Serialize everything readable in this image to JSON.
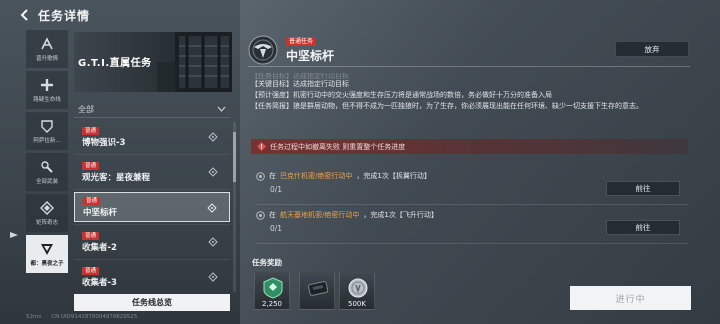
{
  "header": {
    "title": "任务详情"
  },
  "rail": {
    "items": [
      {
        "label": "晋升歌情",
        "icon": "chevron-a-icon",
        "active": false
      },
      {
        "label": "路疑生命线",
        "icon": "plus-cross-icon",
        "active": false
      },
      {
        "label": "阿萨拉新...",
        "icon": "shield-icon",
        "active": false
      },
      {
        "label": "全部武装",
        "icon": "wrench-icon",
        "active": false
      },
      {
        "label": "矩阵奇志",
        "icon": "diamond-icon",
        "active": false
      },
      {
        "label": "都：黑夜之子",
        "icon": "triangle-v-icon",
        "active": true
      }
    ]
  },
  "banner": {
    "title": "G.T.I.直属任务"
  },
  "filter": {
    "label": "全部"
  },
  "tasks": [
    {
      "tag": "普通",
      "name": "博物强识-3",
      "active": false
    },
    {
      "tag": "普通",
      "name": "观光客：星夜兼程",
      "active": false
    },
    {
      "tag": "普通",
      "name": "中坚标杆",
      "active": true
    },
    {
      "tag": "普通",
      "name": "收集者-2",
      "active": false
    },
    {
      "tag": "普通",
      "name": "收集者-3",
      "active": false
    }
  ],
  "overview_button": "任务线总览",
  "footer": {
    "fps": "52ms",
    "uid": "CN UID9142870004879829525"
  },
  "detail": {
    "tag": "普通任务",
    "title": "中坚标杆",
    "abandon_label": "放弃",
    "desc_faded": "【任务目标】达成指定行动目标",
    "desc_lines": [
      "【关键目标】达成指定行动目标",
      "【预计强度】机密行动中的交火强度和生存压力将是通常战场的数倍，务必做好十万分的准备入局",
      "【任务简报】狼是群居动物，但不得不成为一匹独狼时，为了生存，你必须展现出能在任何环境、缺少一切支援下生存的意志。"
    ],
    "warning": "任务过程中如撤离失败 则重置整个任务进度",
    "objectives": [
      {
        "prefix": "在",
        "highlight": "巴克什机密/绝密行动中",
        "suffix": "，完成1次【拆翼行动】",
        "progress": "0/1",
        "button": "前往"
      },
      {
        "prefix": "在",
        "highlight": "航天基地机密/绝密行动中",
        "suffix": "，完成1次【飞升行动】",
        "progress": "0/1",
        "button": "前往"
      }
    ],
    "rewards_title": "任务奖励",
    "rewards": [
      {
        "icon": "currency-badge-icon",
        "qty": "2,250"
      },
      {
        "icon": "supply-case-icon",
        "qty": ""
      },
      {
        "icon": "coin-icon",
        "qty": "500K"
      }
    ],
    "status_label": "进行中"
  },
  "colors": {
    "accent_red": "#c8332f",
    "highlight_orange": "#f0a24a",
    "active_light": "#e8ecee"
  }
}
